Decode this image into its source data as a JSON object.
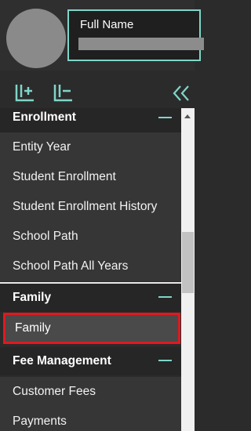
{
  "profile": {
    "name_label": "Full Name"
  },
  "toolbar": {
    "icons": [
      "add-layout-icon",
      "layout-icon",
      "double-chevron-left-icon"
    ]
  },
  "menu": {
    "groups": [
      {
        "title": "Enrollment",
        "items": [
          "Entity Year",
          "Student Enrollment",
          "Student Enrollment History",
          "School Path",
          "School Path All Years"
        ]
      },
      {
        "title": "Family",
        "items": [
          "Family"
        ],
        "selected": "Family"
      },
      {
        "title": "Fee Management",
        "items": [
          "Customer Fees",
          "Payments"
        ]
      }
    ]
  },
  "colors": {
    "accent": "#7fd6c8",
    "selection_border": "#e0191f",
    "background": "#2b2b2b",
    "item_background": "#363636"
  }
}
